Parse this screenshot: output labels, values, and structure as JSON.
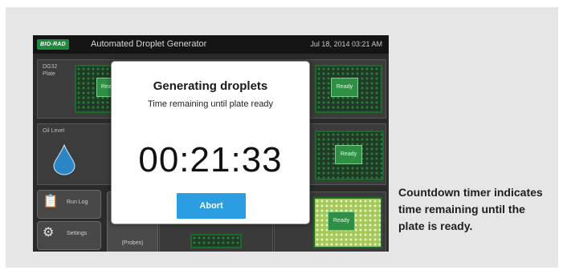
{
  "header": {
    "logo_text": "BIO-RAD",
    "title": "Automated Droplet Generator",
    "datetime": "Jul 18, 2014 03:21 AM"
  },
  "rows": {
    "plate_label_line1": "DG32",
    "plate_label_line2": "Plate",
    "oil_label": "Oil Level"
  },
  "status": {
    "ready_label": "Ready"
  },
  "buttons": {
    "run_log": "Run Log",
    "settings": "Settings",
    "probes": "(Probes)"
  },
  "modal": {
    "title": "Generating droplets",
    "subtitle": "Time remaining until plate ready",
    "timer": "00:21:33",
    "abort_label": "Abort"
  },
  "caption": "Countdown timer indicates time remaining until the plate is ready.",
  "colors": {
    "accent_blue": "#2b9ee2",
    "ready_green": "#2f8f45",
    "panel_bg": "#e6e6e6"
  }
}
